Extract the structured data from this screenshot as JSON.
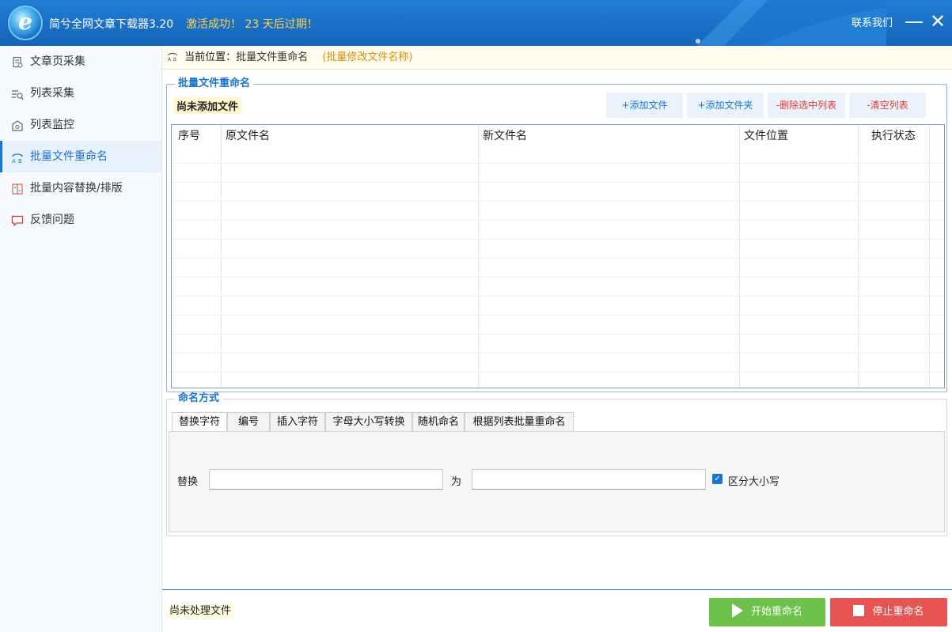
{
  "titlebar": {
    "app_title": "简兮全网文章下载器3.20",
    "activation": "激活成功！ 23 天后过期！",
    "contact": "联系我们",
    "minimize": "—",
    "close": "✕"
  },
  "sidebar": {
    "items": [
      {
        "label": "文章页采集",
        "icon": "page-collect-icon"
      },
      {
        "label": "列表采集",
        "icon": "list-collect-icon"
      },
      {
        "label": "列表监控",
        "icon": "list-monitor-icon"
      },
      {
        "label": "批量文件重命名",
        "icon": "rename-icon",
        "active": true
      },
      {
        "label": "批量内容替换/排版",
        "icon": "replace-icon"
      },
      {
        "label": "反馈问题",
        "icon": "feedback-icon"
      }
    ]
  },
  "breadcrumb": {
    "prefix": "当前位置：",
    "current": "批量文件重命名",
    "hint": "(批量修改文件名称)"
  },
  "file_group": {
    "legend": "批量文件重命名",
    "status": "尚未添加文件",
    "buttons": {
      "add_file": "+添加文件",
      "add_folder": "+添加文件夹",
      "delete_selected": "-删除选中列表",
      "clear_list": "-清空列表"
    },
    "table": {
      "columns": [
        "序号",
        "原文件名",
        "新文件名",
        "文件位置",
        "执行状态"
      ],
      "rows": []
    }
  },
  "naming_group": {
    "legend": "命名方式",
    "tabs": [
      "替换字符",
      "编号",
      "插入字符",
      "字母大小写转换",
      "随机命名",
      "根据列表批量重命名"
    ],
    "active_tab": "替换字符",
    "replace_label": "替换",
    "replace_value": "",
    "with_label": "为",
    "with_value": "",
    "case_sensitive_label": "区分大小写",
    "case_sensitive_checked": true
  },
  "footer": {
    "status": "尚未处理文件",
    "start_button": "开始重命名",
    "stop_button": "停止重命名"
  },
  "colors": {
    "accent": "#1a73d0",
    "start": "#6cc24a",
    "stop": "#e75454",
    "danger_text": "#e03a2f",
    "activation_text": "#ffd34d"
  }
}
